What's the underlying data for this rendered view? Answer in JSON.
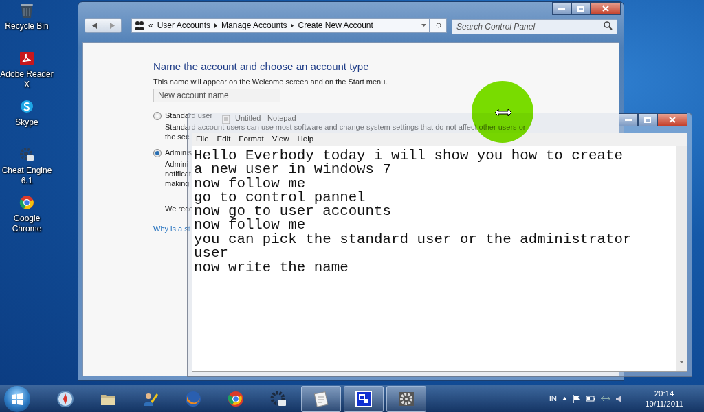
{
  "desktop_icons": [
    {
      "kind": "bin",
      "label": "Recycle Bin"
    },
    {
      "kind": "pdf",
      "label": "Adobe Reader X"
    },
    {
      "kind": "chat",
      "label": "Skype"
    },
    {
      "kind": "gear",
      "label": "Cheat Engine 6.1"
    },
    {
      "kind": "browser",
      "label": "Google Chrome"
    }
  ],
  "control_panel": {
    "breadcrumb_prefix": "«",
    "breadcrumb": [
      "User Accounts",
      "Manage Accounts",
      "Create New Account"
    ],
    "search": {
      "placeholder": "Search Control Panel"
    },
    "heading": "Name the account and choose an account type",
    "subtitle": "This name will appear on the Welcome screen and on the Start menu.",
    "name_field": {
      "placeholder": "New account name"
    },
    "account_types": [
      {
        "label": "Standard user",
        "selected": false,
        "description": [
          "Standard account users can use most software and change system settings that do not affect other users or",
          "the sec"
        ]
      },
      {
        "label": "Adminis",
        "selected": true,
        "description": [
          "Admini",
          "notificat",
          "making"
        ]
      }
    ],
    "recommendation": "We reco",
    "link": "Why is a st"
  },
  "notepad": {
    "title": "Untitled - Notepad",
    "menu": [
      "File",
      "Edit",
      "Format",
      "View",
      "Help"
    ],
    "lines": [
      "Hello Everbody today i will show you how to create",
      "a new user in windows 7",
      "now follow me",
      "go to control pannel",
      "now go to user accounts",
      "now follow me",
      "you can pick the standard user or the administrator",
      "user",
      "now write the name"
    ]
  },
  "taskbar": {
    "apps": [
      {
        "kind": "compass",
        "active": false
      },
      {
        "kind": "folder",
        "active": false
      },
      {
        "kind": "people",
        "active": false
      },
      {
        "kind": "fox",
        "active": false
      },
      {
        "kind": "wheel",
        "active": false
      },
      {
        "kind": "gear",
        "active": false
      },
      {
        "kind": "notepad",
        "active": true
      },
      {
        "kind": "window",
        "active": true
      },
      {
        "kind": "cog",
        "active": true
      }
    ],
    "language": "IN",
    "time": "20:14",
    "date": "19/11/2011"
  }
}
